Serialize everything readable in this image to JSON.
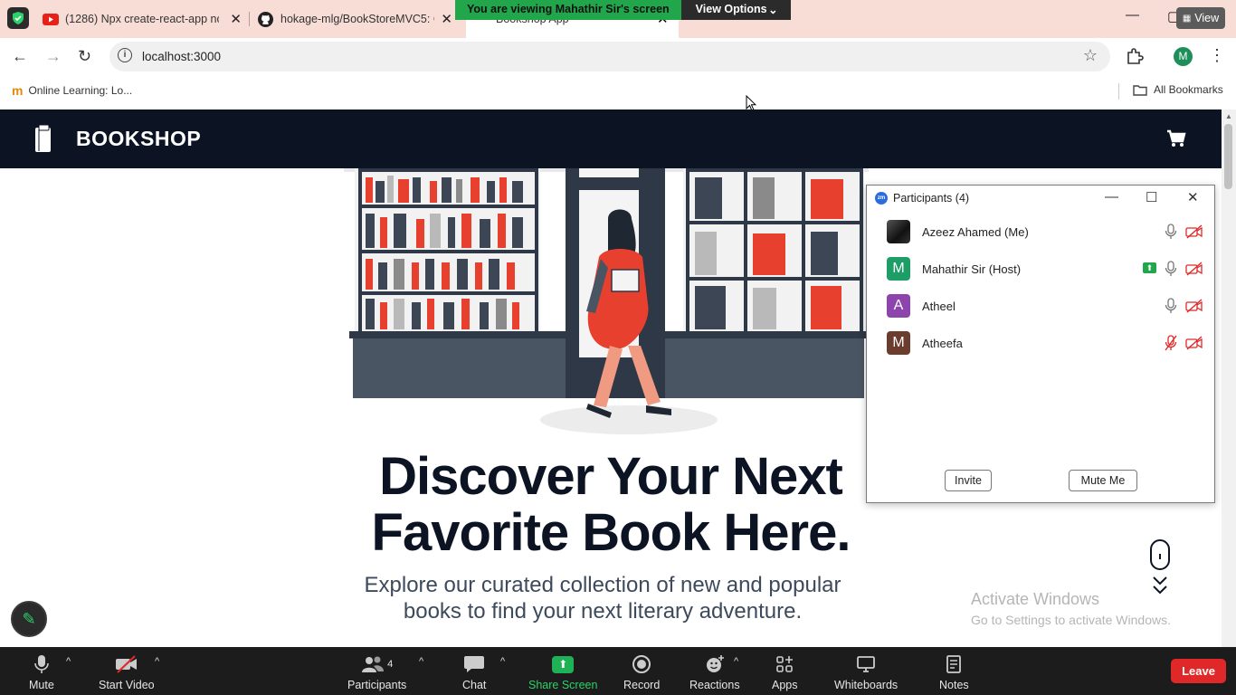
{
  "browser": {
    "tabs": [
      {
        "title": "(1286) Npx create-react-app no",
        "icon": "youtube-icon"
      },
      {
        "title": "hokage-mlg/BookStoreMVC5: C",
        "icon": "github-icon"
      },
      {
        "title": "Bookshop App",
        "icon": "react-icon"
      }
    ],
    "url": "localhost:3000",
    "profile_initial": "M",
    "view_label": "View",
    "bookmarks": {
      "item": "Online Learning: Lo...",
      "all": "All Bookmarks"
    }
  },
  "share_banner": {
    "viewing": "You are viewing Mahathir Sir's screen",
    "view_options": "View Options"
  },
  "site": {
    "brand": "BOOKSHOP",
    "hero_title": "Discover Your Next Favorite Book Here.",
    "hero_subtitle": "Explore our curated collection of new and popular books to find your next literary adventure."
  },
  "participants_panel": {
    "title": "Participants (4)",
    "participants": [
      {
        "name": "Azeez Ahamed (Me)",
        "initial": "",
        "color": "#222222",
        "sharing": false,
        "muted": false
      },
      {
        "name": "Mahathir Sir (Host)",
        "initial": "M",
        "color": "#1e9e67",
        "sharing": true,
        "muted": false
      },
      {
        "name": "Atheel",
        "initial": "A",
        "color": "#8e44ad",
        "sharing": false,
        "muted": false
      },
      {
        "name": "Atheefa",
        "initial": "M",
        "color": "#6b3d2e",
        "sharing": false,
        "muted": true
      }
    ],
    "invite": "Invite",
    "mute_me": "Mute Me"
  },
  "watermark": {
    "line1": "Activate Windows",
    "line2": "Go to Settings to activate Windows."
  },
  "zoom_bar": {
    "mute": "Mute",
    "start_video": "Start Video",
    "participants": "Participants",
    "participants_count": "4",
    "chat": "Chat",
    "share_screen": "Share Screen",
    "record": "Record",
    "reactions": "Reactions",
    "apps": "Apps",
    "whiteboards": "Whiteboards",
    "notes": "Notes",
    "leave": "Leave"
  },
  "colors": {
    "nav_bg": "#0c1424",
    "accent_red": "#e8402f",
    "zoom_green": "#22a64b",
    "leave_red": "#e02828"
  }
}
